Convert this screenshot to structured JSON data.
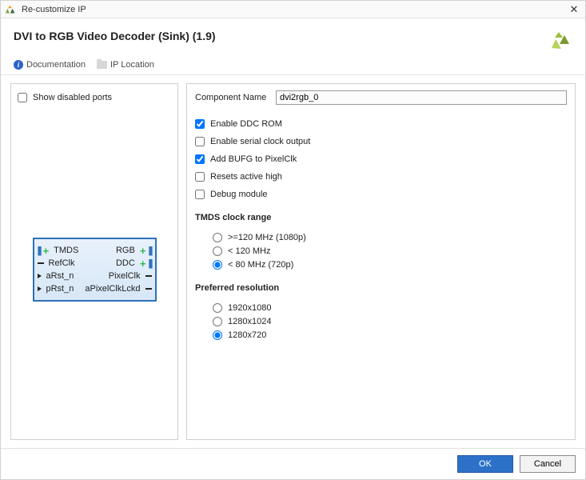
{
  "window": {
    "title": "Re-customize IP",
    "close_glyph": "✕"
  },
  "header": {
    "ip_name": "DVI to RGB Video Decoder (Sink) (1.9)"
  },
  "toolbar": {
    "documentation": "Documentation",
    "ip_location": "IP Location"
  },
  "left": {
    "show_disabled_label": "Show disabled ports",
    "show_disabled_checked": false,
    "ports_left": [
      {
        "name": "TMDS",
        "kind": "bus_in"
      },
      {
        "name": "RefClk",
        "kind": "clk_in"
      },
      {
        "name": "aRst_n",
        "kind": "in"
      },
      {
        "name": "pRst_n",
        "kind": "in"
      }
    ],
    "ports_right": [
      {
        "name": "RGB",
        "kind": "bus_out"
      },
      {
        "name": "DDC",
        "kind": "bus_out"
      },
      {
        "name": "PixelClk",
        "kind": "out"
      },
      {
        "name": "aPixelClkLckd",
        "kind": "out"
      }
    ]
  },
  "right": {
    "component_name_label": "Component Name",
    "component_name": "dvi2rgb_0",
    "checks": [
      {
        "key": "enable_ddc_rom",
        "label": "Enable DDC ROM",
        "checked": true
      },
      {
        "key": "enable_serial",
        "label": "Enable serial clock output",
        "checked": false
      },
      {
        "key": "add_bufg",
        "label": "Add BUFG to PixelClk",
        "checked": true
      },
      {
        "key": "resets_high",
        "label": "Resets active high",
        "checked": false
      },
      {
        "key": "debug_module",
        "label": "Debug module",
        "checked": false
      }
    ],
    "tmds_title": "TMDS clock range",
    "tmds_options": [
      {
        "label": ">=120 MHz (1080p)",
        "selected": false
      },
      {
        "label": "< 120 MHz",
        "selected": false
      },
      {
        "label": "< 80 MHz (720p)",
        "selected": true
      }
    ],
    "res_title": "Preferred resolution",
    "res_options": [
      {
        "label": "1920x1080",
        "selected": false
      },
      {
        "label": "1280x1024",
        "selected": false
      },
      {
        "label": "1280x720",
        "selected": true
      }
    ]
  },
  "footer": {
    "ok": "OK",
    "cancel": "Cancel"
  }
}
